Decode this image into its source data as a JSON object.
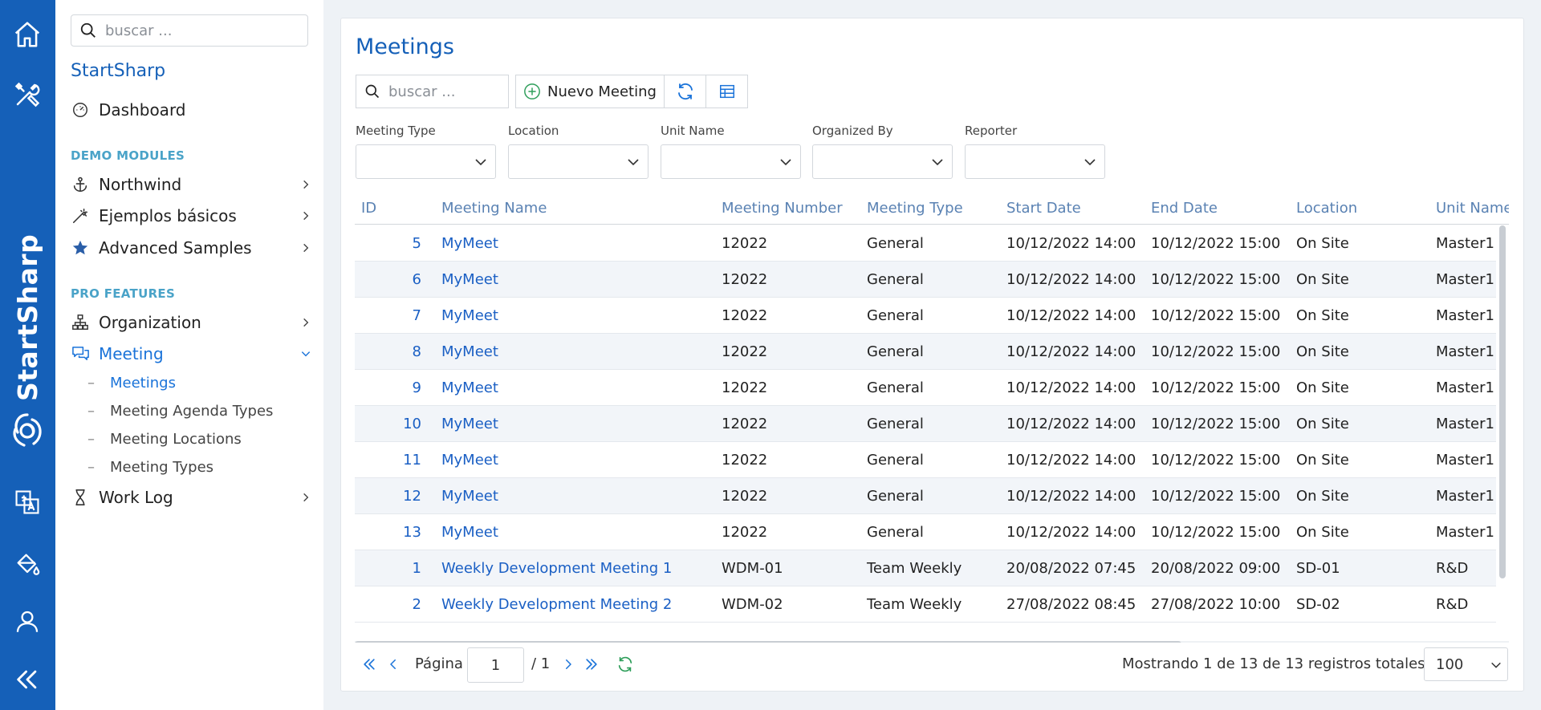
{
  "rail": {
    "brand": "StartSharp",
    "icons": [
      "home-icon",
      "tools-icon",
      "translate-icon",
      "paint-bucket-icon",
      "user-icon",
      "collapse-icon"
    ]
  },
  "sidebar": {
    "search_placeholder": "buscar ...",
    "brand": "StartSharp",
    "dashboard": "Dashboard",
    "sections": {
      "demo": "DEMO MODULES",
      "pro": "PRO FEATURES"
    },
    "items": {
      "northwind": "Northwind",
      "ejemplos": "Ejemplos básicos",
      "advanced": "Advanced Samples",
      "organization": "Organization",
      "meeting": "Meeting",
      "worklog": "Work Log"
    },
    "subitems": {
      "meetings": "Meetings",
      "agenda_types": "Meeting Agenda Types",
      "locations": "Meeting Locations",
      "types": "Meeting Types"
    },
    "sub_dash": "–"
  },
  "main": {
    "title": "Meetings",
    "search_placeholder": "buscar ...",
    "new_button": "Nuevo Meeting",
    "filters": {
      "meeting_type": "Meeting Type",
      "location": "Location",
      "unit_name": "Unit Name",
      "organized_by": "Organized By",
      "reporter": "Reporter"
    }
  },
  "grid": {
    "columns": [
      "ID",
      "Meeting Name",
      "Meeting Number",
      "Meeting Type",
      "Start Date",
      "End Date",
      "Location",
      "Unit Name"
    ],
    "rows": [
      [
        "5",
        "MyMeet",
        "12022",
        "General",
        "10/12/2022 14:00",
        "10/12/2022 15:00",
        "On Site",
        "Master1"
      ],
      [
        "6",
        "MyMeet",
        "12022",
        "General",
        "10/12/2022 14:00",
        "10/12/2022 15:00",
        "On Site",
        "Master1"
      ],
      [
        "7",
        "MyMeet",
        "12022",
        "General",
        "10/12/2022 14:00",
        "10/12/2022 15:00",
        "On Site",
        "Master1"
      ],
      [
        "8",
        "MyMeet",
        "12022",
        "General",
        "10/12/2022 14:00",
        "10/12/2022 15:00",
        "On Site",
        "Master1"
      ],
      [
        "9",
        "MyMeet",
        "12022",
        "General",
        "10/12/2022 14:00",
        "10/12/2022 15:00",
        "On Site",
        "Master1"
      ],
      [
        "10",
        "MyMeet",
        "12022",
        "General",
        "10/12/2022 14:00",
        "10/12/2022 15:00",
        "On Site",
        "Master1"
      ],
      [
        "11",
        "MyMeet",
        "12022",
        "General",
        "10/12/2022 14:00",
        "10/12/2022 15:00",
        "On Site",
        "Master1"
      ],
      [
        "12",
        "MyMeet",
        "12022",
        "General",
        "10/12/2022 14:00",
        "10/12/2022 15:00",
        "On Site",
        "Master1"
      ],
      [
        "13",
        "MyMeet",
        "12022",
        "General",
        "10/12/2022 14:00",
        "10/12/2022 15:00",
        "On Site",
        "Master1"
      ],
      [
        "1",
        "Weekly Development Meeting 1",
        "WDM-01",
        "Team Weekly",
        "20/08/2022 07:45",
        "20/08/2022 09:00",
        "SD-01",
        "R&D"
      ],
      [
        "2",
        "Weekly Development Meeting 2",
        "WDM-02",
        "Team Weekly",
        "27/08/2022 08:45",
        "27/08/2022 10:00",
        "SD-02",
        "R&D"
      ]
    ]
  },
  "pager": {
    "page_label": "Página",
    "page_value": "1",
    "total_pages": "/ 1",
    "status": "Mostrando 1 de 13 de 13 registros totales",
    "page_size": "100"
  },
  "colors": {
    "brand_blue": "#1560b8",
    "link_blue": "#1a5fc4",
    "accent_green": "#2e9e5a"
  }
}
